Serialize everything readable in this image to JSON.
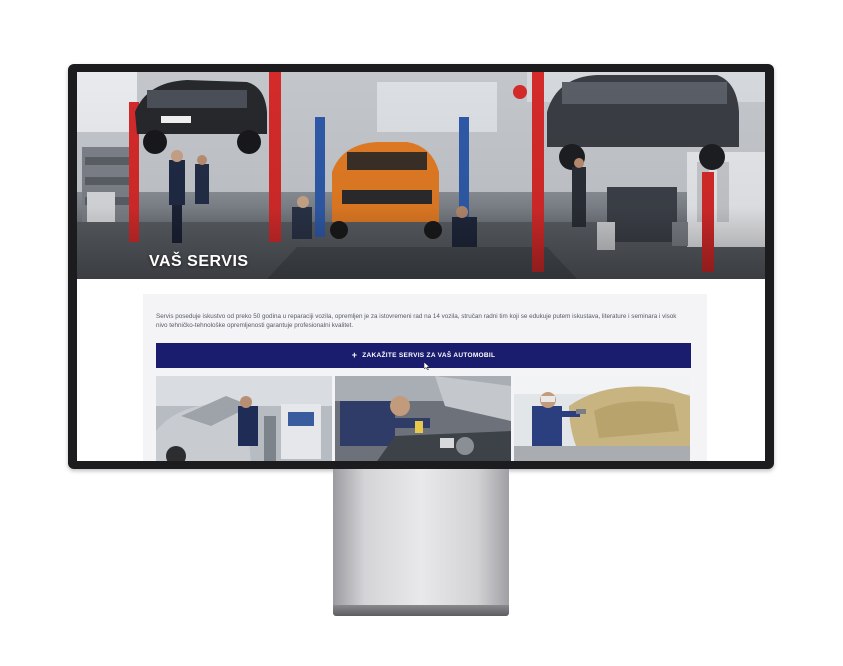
{
  "hero": {
    "title": "VAŠ SERVIS"
  },
  "content": {
    "intro": "Servis poseduje iskustvo od preko 50 godina u reparaciji vozila, opremljen je za istovremeni rad na 14 vozila, stručan radni tim koji se edukuje putem iskustava, literature i seminara i visok nivo tehničko-tehnološke opremljenosti garantuje profesionalni kvalitet.",
    "cta_label": "ZAKAŽITE SERVIS ZA VAŠ AUTOMOBIL",
    "cta_icon": "plus-icon"
  },
  "colors": {
    "cta_bg": "#1a1d6e",
    "lift_red": "#d42a2a",
    "accent_orange": "#e27b24"
  }
}
